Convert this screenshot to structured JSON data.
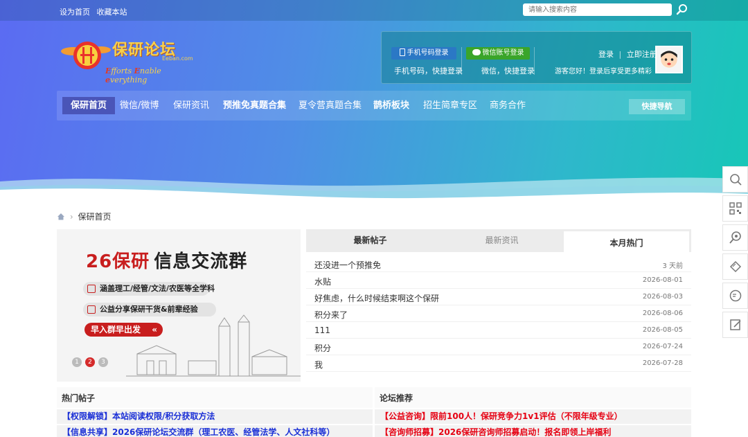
{
  "topbar": {
    "set_home": "设为首页",
    "bookmark": "收藏本站",
    "search_placeholder": "请输入搜索内容"
  },
  "logo": {
    "name": "保研论坛",
    "domain": "Eeban.com",
    "slogan_parts": [
      "E",
      "fforts ",
      "E",
      "nable ",
      "e",
      "verything"
    ]
  },
  "login": {
    "phone_button": "手机号码登录",
    "phone_sub": "手机号码，快捷登录",
    "wechat_button": "微信账号登录",
    "wechat_sub": "微信，快捷登录",
    "login": "登录",
    "sep": "|",
    "register": "立即注册",
    "guest_text": "游客您好！登录后享受更多精彩"
  },
  "nav": {
    "items": [
      {
        "label": "保研首页"
      },
      {
        "label": "微信/微博"
      },
      {
        "label": "保研资讯"
      },
      {
        "label": "预推免真题合集"
      },
      {
        "label": "夏令营真题合集"
      },
      {
        "label": "鹊桥板块"
      },
      {
        "label": "招生简章专区"
      },
      {
        "label": "商务合作"
      }
    ],
    "quick_nav": "快捷导航"
  },
  "breadcrumb": {
    "sep": "›",
    "current": "保研首页"
  },
  "banner": {
    "title_red": "26保研",
    "title_rest": "信息交流群",
    "bullet1": "涵盖理工/经管/文法/农医等全学科",
    "bullet2": "公益分享保研干货&前辈经验",
    "cta": "早入群早出发",
    "dots": [
      "1",
      "2",
      "3"
    ],
    "active_dot": 1
  },
  "tabs": {
    "latest_posts": "最新帖子",
    "latest_news": "最新资讯",
    "monthly_hot": "本月热门"
  },
  "posts": [
    {
      "title": "还没进一个预推免",
      "date": "3 天前"
    },
    {
      "title": "水贴",
      "date": "2026-08-01"
    },
    {
      "title": "好焦虑，什么时候结束啊这个保研",
      "date": "2026-08-03"
    },
    {
      "title": "积分来了",
      "date": "2026-08-06"
    },
    {
      "title": "111",
      "date": "2026-08-05"
    },
    {
      "title": "积分",
      "date": "2026-07-24"
    },
    {
      "title": "我",
      "date": "2026-07-28"
    }
  ],
  "hot_posts": {
    "title": "热门帖子",
    "items": [
      "【权限解锁】本站阅读权限/积分获取方法",
      "【信息共享】2026保研论坛交流群（理工农医、经管法学、人文社科等）"
    ]
  },
  "forum_recommend": {
    "title": "论坛推荐",
    "items": [
      "【公益咨询】限前100人！保研竞争力1v1评估（不限年级专业）",
      "【咨询师招募】2026保研咨询师招募启动！报名即领上岸福利"
    ]
  },
  "colors": {
    "accent_red": "#e60012",
    "link_blue": "#1a2fd6",
    "nav_active": "#4a55b8",
    "phone_btn": "#2b78c5",
    "wechat_btn": "#3aa52a"
  },
  "sidebar_icons": [
    "search-icon",
    "qrcode-icon",
    "magnifier-icon",
    "ticket-icon",
    "feedback-icon",
    "edit-icon"
  ]
}
